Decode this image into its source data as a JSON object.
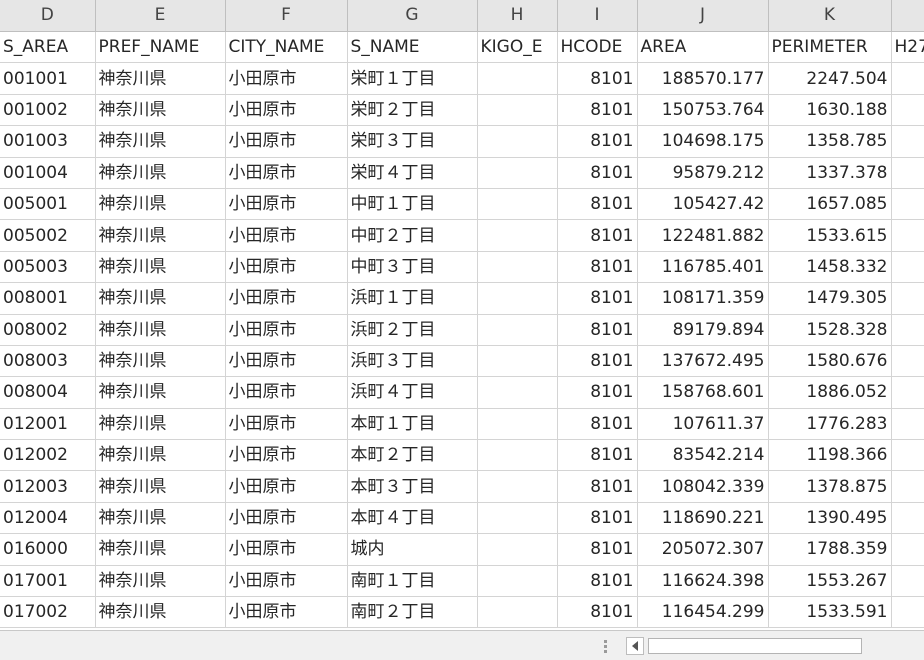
{
  "columns": [
    "D",
    "E",
    "F",
    "G",
    "H",
    "I",
    "J",
    "K",
    ""
  ],
  "headers": [
    "S_AREA",
    "PREF_NAME",
    "CITY_NAME",
    "S_NAME",
    "KIGO_E",
    "HCODE",
    "AREA",
    "PERIMETER",
    "H27"
  ],
  "rows": [
    [
      "001001",
      "神奈川県",
      "小田原市",
      "栄町１丁目",
      "",
      "8101",
      "188570.177",
      "2247.504"
    ],
    [
      "001002",
      "神奈川県",
      "小田原市",
      "栄町２丁目",
      "",
      "8101",
      "150753.764",
      "1630.188"
    ],
    [
      "001003",
      "神奈川県",
      "小田原市",
      "栄町３丁目",
      "",
      "8101",
      "104698.175",
      "1358.785"
    ],
    [
      "001004",
      "神奈川県",
      "小田原市",
      "栄町４丁目",
      "",
      "8101",
      "95879.212",
      "1337.378"
    ],
    [
      "005001",
      "神奈川県",
      "小田原市",
      "中町１丁目",
      "",
      "8101",
      "105427.42",
      "1657.085"
    ],
    [
      "005002",
      "神奈川県",
      "小田原市",
      "中町２丁目",
      "",
      "8101",
      "122481.882",
      "1533.615"
    ],
    [
      "005003",
      "神奈川県",
      "小田原市",
      "中町３丁目",
      "",
      "8101",
      "116785.401",
      "1458.332"
    ],
    [
      "008001",
      "神奈川県",
      "小田原市",
      "浜町１丁目",
      "",
      "8101",
      "108171.359",
      "1479.305"
    ],
    [
      "008002",
      "神奈川県",
      "小田原市",
      "浜町２丁目",
      "",
      "8101",
      "89179.894",
      "1528.328"
    ],
    [
      "008003",
      "神奈川県",
      "小田原市",
      "浜町３丁目",
      "",
      "8101",
      "137672.495",
      "1580.676"
    ],
    [
      "008004",
      "神奈川県",
      "小田原市",
      "浜町４丁目",
      "",
      "8101",
      "158768.601",
      "1886.052"
    ],
    [
      "012001",
      "神奈川県",
      "小田原市",
      "本町１丁目",
      "",
      "8101",
      "107611.37",
      "1776.283"
    ],
    [
      "012002",
      "神奈川県",
      "小田原市",
      "本町２丁目",
      "",
      "8101",
      "83542.214",
      "1198.366"
    ],
    [
      "012003",
      "神奈川県",
      "小田原市",
      "本町３丁目",
      "",
      "8101",
      "108042.339",
      "1378.875"
    ],
    [
      "012004",
      "神奈川県",
      "小田原市",
      "本町４丁目",
      "",
      "8101",
      "118690.221",
      "1390.495"
    ],
    [
      "016000",
      "神奈川県",
      "小田原市",
      "城内",
      "",
      "8101",
      "205072.307",
      "1788.359"
    ],
    [
      "017001",
      "神奈川県",
      "小田原市",
      "南町１丁目",
      "",
      "8101",
      "116624.398",
      "1553.267"
    ],
    [
      "017002",
      "神奈川県",
      "小田原市",
      "南町２丁目",
      "",
      "8101",
      "116454.299",
      "1533.591"
    ]
  ],
  "icons": {
    "scroll_left": "scroll-left-arrow-icon",
    "grip": "sheet-tab-splitter-icon"
  }
}
